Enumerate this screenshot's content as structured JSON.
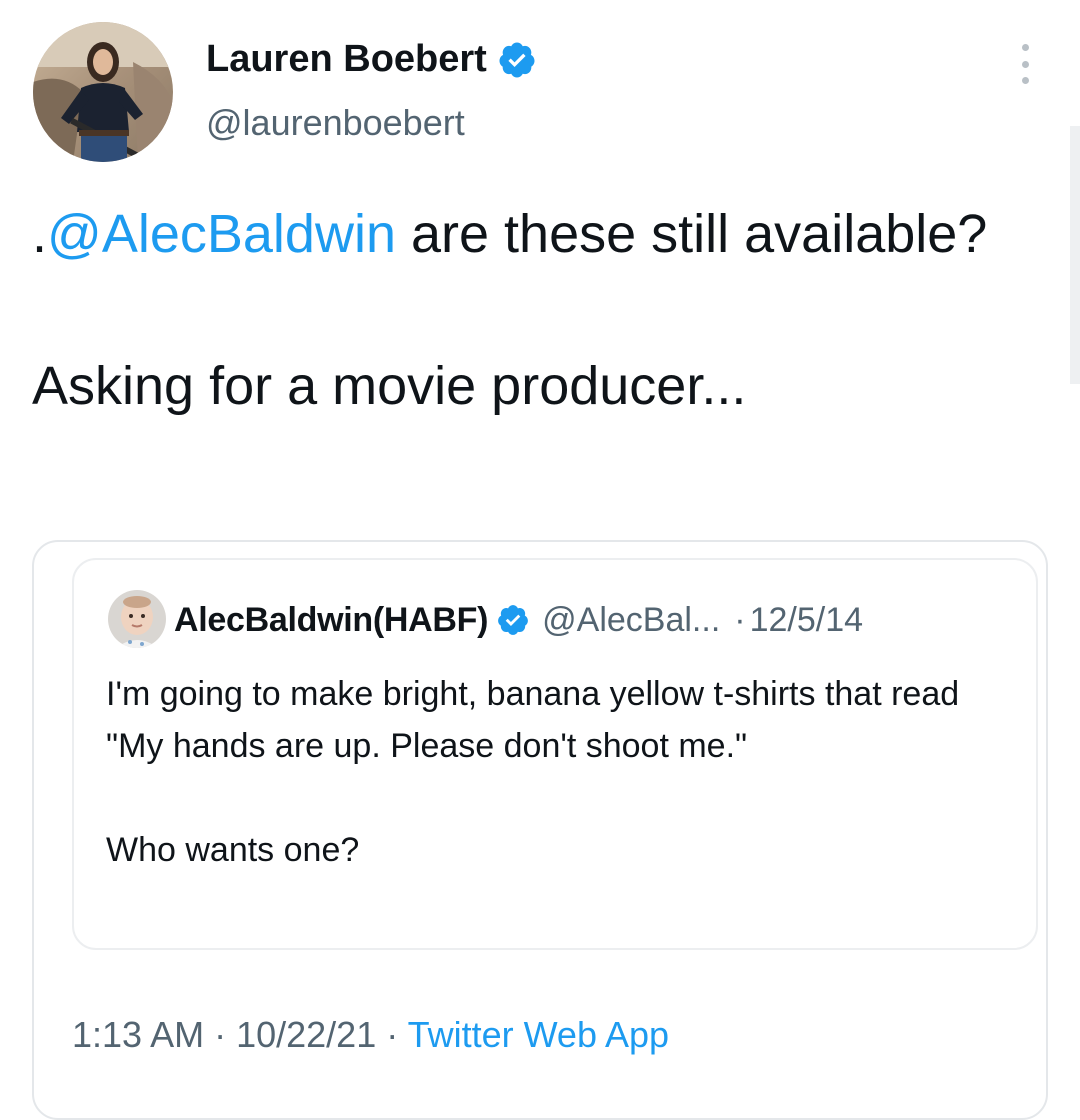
{
  "author": {
    "display_name": "Lauren Boebert",
    "handle": "@laurenboebert",
    "verified_icon": "verified-badge-icon",
    "avatar_icon": "profile-photo"
  },
  "tweet": {
    "prefix": ".",
    "mention": "@AlecBaldwin",
    "line1_rest": " are these still available?",
    "paragraph2": "Asking for a movie producer..."
  },
  "quoted_tweet": {
    "display_name": "AlecBaldwin(HABF)",
    "handle": "@AlecBal...",
    "separator": "·",
    "date": "12/5/14",
    "paragraph1": "I'm going to make bright, banana yellow t-shirts that read \"My hands are up. Please don't shoot me.\"",
    "paragraph2": "Who wants one?"
  },
  "meta": {
    "time": "1:13 AM",
    "sep1": " · ",
    "date": "10/22/21",
    "sep2": " · ",
    "source": "Twitter Web App"
  },
  "icons": {
    "more": "more-options-icon"
  },
  "colors": {
    "link": "#1d9bf0",
    "secondary_text": "#536471",
    "primary_text": "#0f1419",
    "border": "#e4e7ea"
  }
}
